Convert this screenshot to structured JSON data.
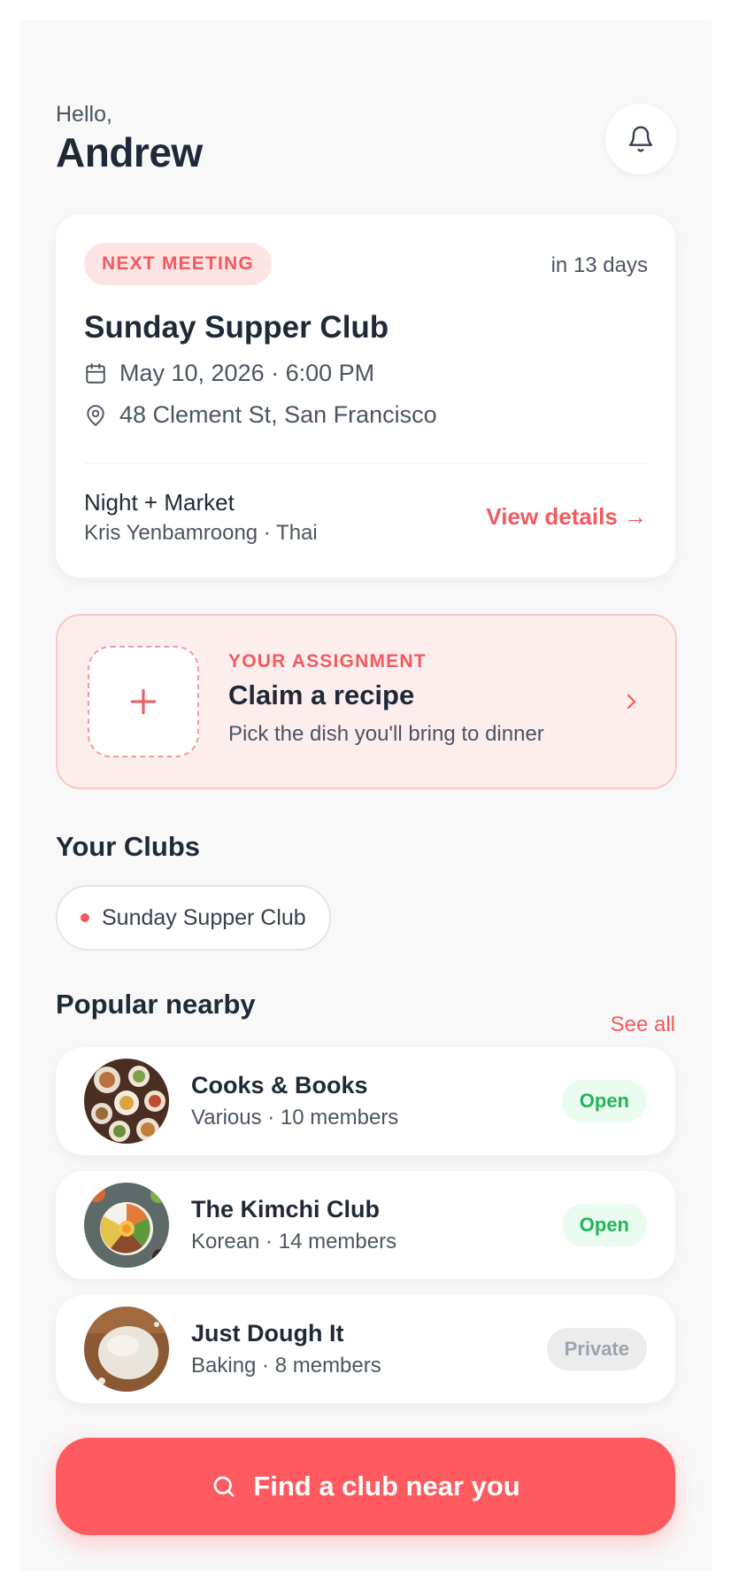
{
  "header": {
    "greeting": "Hello,",
    "user_name": "Andrew"
  },
  "next_meeting": {
    "badge": "NEXT MEETING",
    "countdown": "in 13 days",
    "club_name": "Sunday Supper Club",
    "datetime": "May 10, 2026 · 6:00 PM",
    "location": "48 Clement St, San Francisco",
    "theme": "Night + Market",
    "host_line": "Kris Yenbamroong · Thai",
    "link": "View details →"
  },
  "assignment": {
    "kicker": "YOUR ASSIGNMENT",
    "title": "Claim a recipe",
    "subtitle": "Pick the dish you'll bring to dinner"
  },
  "your_clubs": {
    "title": "Your Clubs",
    "clubs": [
      "Sunday Supper Club"
    ]
  },
  "popular": {
    "title": "Popular nearby",
    "see_all": "See all",
    "items": [
      {
        "name": "Cooks & Books",
        "meta": "Various · 10 members",
        "status": "Open"
      },
      {
        "name": "The Kimchi Club",
        "meta": "Korean · 14 members",
        "status": "Open"
      },
      {
        "name": "Just Dough It",
        "meta": "Baking · 8 members",
        "status": "Private"
      }
    ]
  },
  "cta": {
    "label": "Find a club near you"
  },
  "colors": {
    "accent": "#fe5a5f",
    "open_green": "#22b45a",
    "private_gray": "#9ca3af"
  },
  "icons": [
    "bell-icon",
    "calendar-icon",
    "location-pin-icon",
    "plus-icon",
    "chevron-right-icon",
    "search-icon"
  ]
}
